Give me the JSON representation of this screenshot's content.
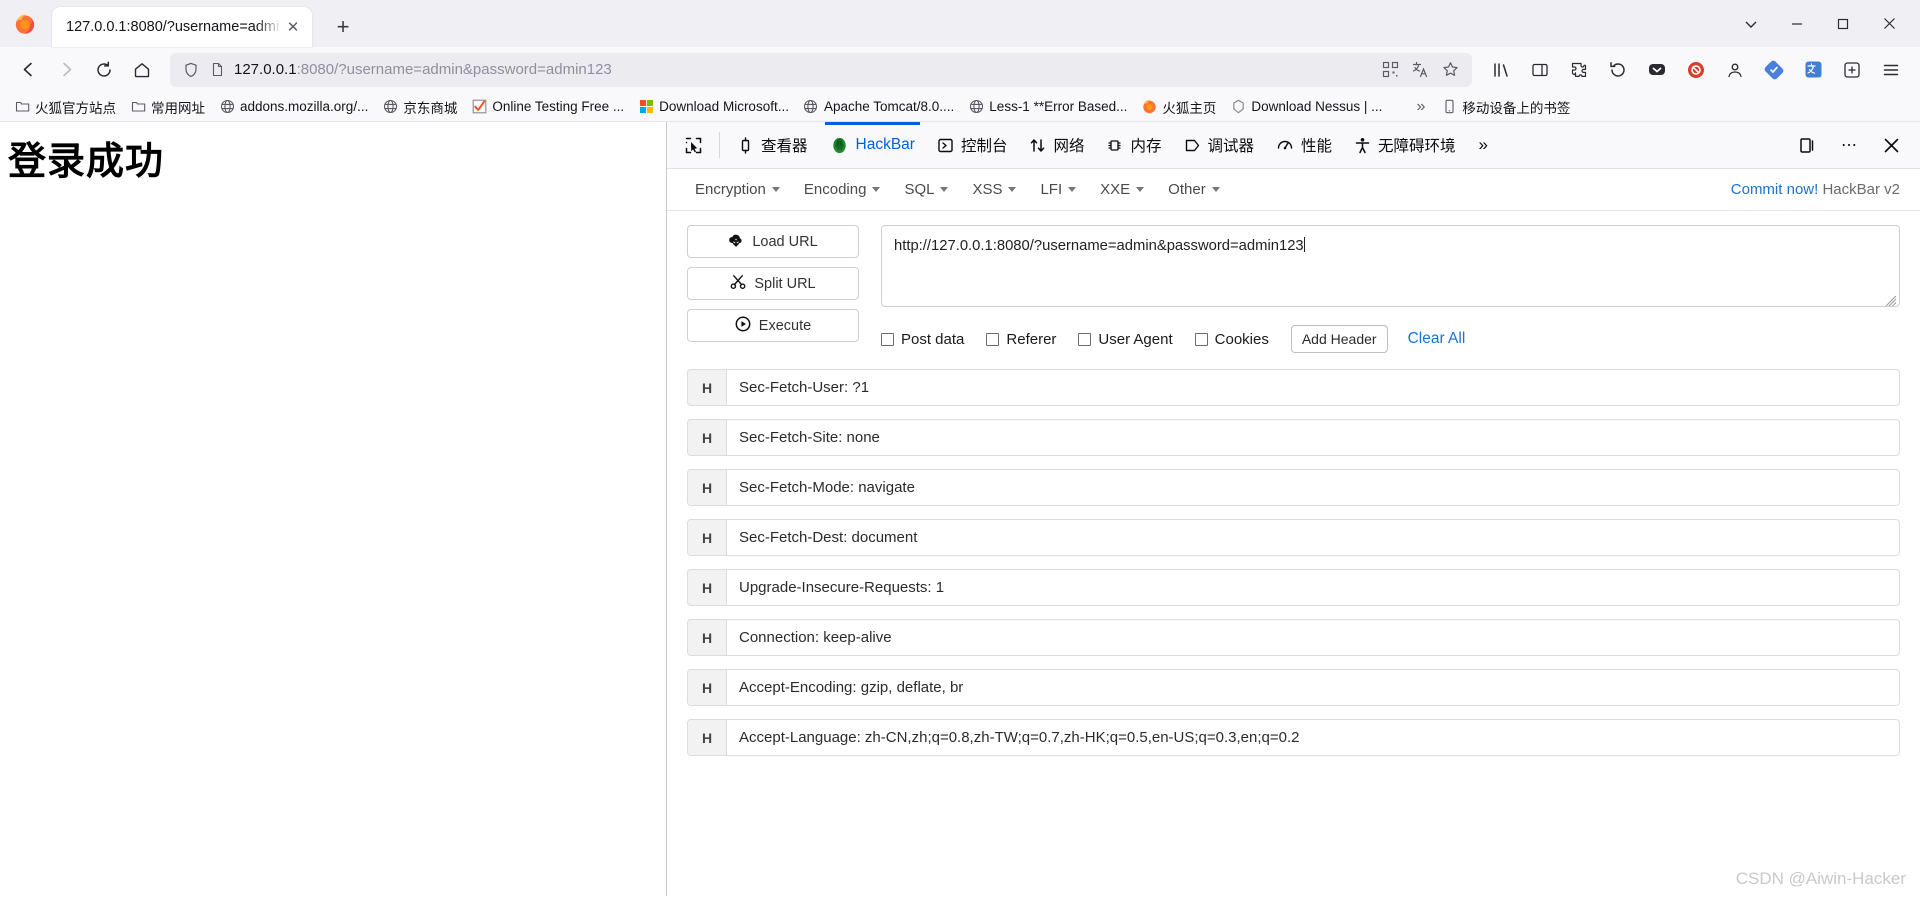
{
  "browser": {
    "tab": {
      "title": "127.0.0.1:8080/?username=admi",
      "close_label": "✕"
    },
    "newtab_label": "+",
    "window_controls": {
      "list_all_tabs": "⌄",
      "minimize": "—",
      "maximize": "▭",
      "close": "✕"
    },
    "nav": {
      "back": "←",
      "forward": "→",
      "reload": "⟳",
      "home": "⌂"
    },
    "url": {
      "host": "127.0.0.1",
      "rest": ":8080/?username=admin&password=admin123",
      "full": "127.0.0.1:8080/?username=admin&password=admin123"
    },
    "url_actions": {
      "qrcode": "qr-icon",
      "translate": "translate-icon",
      "bookmark": "star-icon"
    },
    "toolbar_right": {
      "library": "library-icon",
      "sidebar": "sidebar-icon",
      "extension": "puzzle-icon",
      "undo": "undo-icon",
      "pocket": "pocket-icon",
      "shield": "shield-icon",
      "account": "account-icon",
      "sync": "sync-icon",
      "translate2": "translate-icon",
      "addons": "addons-icon",
      "menu": "hamburger-icon"
    },
    "bookmarks": [
      {
        "label": "火狐官方站点",
        "icon": "folder"
      },
      {
        "label": "常用网址",
        "icon": "folder"
      },
      {
        "label": "addons.mozilla.org/...",
        "icon": "globe"
      },
      {
        "label": "京东商城",
        "icon": "globe"
      },
      {
        "label": "Online Testing Free ...",
        "icon": "check"
      },
      {
        "label": "Download Microsoft...",
        "icon": "microsoft"
      },
      {
        "label": "Apache Tomcat/8.0....",
        "icon": "globe"
      },
      {
        "label": "Less-1 **Error Based...",
        "icon": "globe"
      },
      {
        "label": "火狐主页",
        "icon": "firefox"
      },
      {
        "label": "Download Nessus | ...",
        "icon": "nessus"
      }
    ],
    "bookmarks_overflow": "»",
    "bookmarks_mobile": {
      "label": "移动设备上的书签",
      "icon": "phone"
    }
  },
  "page": {
    "heading": "登录成功"
  },
  "devtools": {
    "picker_icon": "element-picker-icon",
    "tabs": [
      {
        "label": "查看器",
        "icon": "inspector-icon",
        "active": false
      },
      {
        "label": "HackBar",
        "icon": "hackbar-icon",
        "active": true
      },
      {
        "label": "控制台",
        "icon": "console-icon",
        "active": false
      },
      {
        "label": "网络",
        "icon": "network-icon",
        "active": false
      },
      {
        "label": "内存",
        "icon": "memory-icon",
        "active": false
      },
      {
        "label": "调试器",
        "icon": "debugger-icon",
        "active": false
      },
      {
        "label": "性能",
        "icon": "performance-icon",
        "active": false
      },
      {
        "label": "无障碍环境",
        "icon": "accessibility-icon",
        "active": false
      }
    ],
    "overflow_label": "»",
    "right_buttons": {
      "dock": "dock-icon",
      "meatball": "⋯",
      "close": "✕"
    }
  },
  "hackbar": {
    "menu": [
      {
        "label": "Encryption"
      },
      {
        "label": "Encoding"
      },
      {
        "label": "SQL"
      },
      {
        "label": "XSS"
      },
      {
        "label": "LFI"
      },
      {
        "label": "XXE"
      },
      {
        "label": "Other"
      }
    ],
    "commit_link": "Commit now!",
    "version": "HackBar v2",
    "buttons": [
      {
        "label": "Load URL",
        "icon": "cloud-download-icon"
      },
      {
        "label": "Split URL",
        "icon": "scissors-icon"
      },
      {
        "label": "Execute",
        "icon": "play-icon"
      }
    ],
    "url_value": "http://127.0.0.1:8080/?username=admin&password=admin123",
    "checkboxes": [
      {
        "label": "Post data",
        "checked": false
      },
      {
        "label": "Referer",
        "checked": false
      },
      {
        "label": "User Agent",
        "checked": false
      },
      {
        "label": "Cookies",
        "checked": false
      }
    ],
    "add_header_label": "Add Header",
    "clear_all_label": "Clear All",
    "header_tag": "H",
    "headers": [
      "Sec-Fetch-User: ?1",
      "Sec-Fetch-Site: none",
      "Sec-Fetch-Mode: navigate",
      "Sec-Fetch-Dest: document",
      "Upgrade-Insecure-Requests: 1",
      "Connection: keep-alive",
      "Accept-Encoding: gzip, deflate, br",
      "Accept-Language: zh-CN,zh;q=0.8,zh-TW;q=0.7,zh-HK;q=0.5,en-US;q=0.3,en;q=0.2"
    ]
  },
  "watermark": "CSDN @Aiwin-Hacker",
  "colors": {
    "accent": "#0060df",
    "link": "#1a73cc",
    "chrome_bg": "#f9f9fb",
    "tabstrip_bg": "#f0f0f4"
  }
}
